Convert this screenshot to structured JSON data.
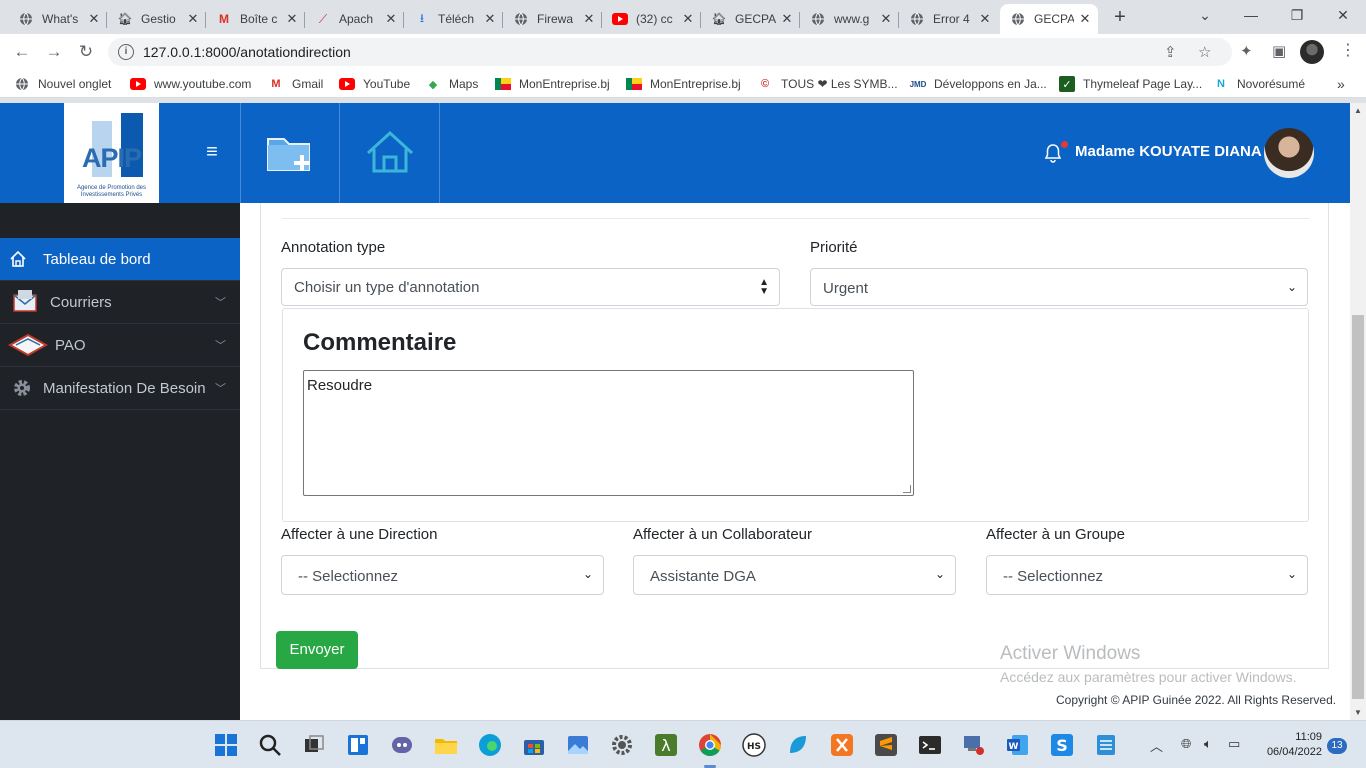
{
  "browser": {
    "tabs": [
      {
        "label": "What's",
        "icon": "globe-icon"
      },
      {
        "label": "Gestio",
        "icon": "house-icon"
      },
      {
        "label": "Boîte c",
        "icon": "gmail-icon"
      },
      {
        "label": "Apach",
        "icon": "apache-icon"
      },
      {
        "label": "Téléch",
        "icon": "download-icon"
      },
      {
        "label": "Firewa",
        "icon": "globe-icon"
      },
      {
        "label": "(32) cc",
        "icon": "youtube-icon"
      },
      {
        "label": "GECPA",
        "icon": "house-icon"
      },
      {
        "label": "www.g",
        "icon": "globe-icon"
      },
      {
        "label": "Error 4",
        "icon": "globe-icon"
      },
      {
        "label": "GECPA",
        "icon": "globe-icon"
      }
    ],
    "url": "127.0.0.1:8000/anotationdirection",
    "bookmarks": [
      "Nouvel onglet",
      "www.youtube.com",
      "Gmail",
      "YouTube",
      "Maps",
      "MonEntreprise.bj",
      "MonEntreprise.bj",
      "TOUS ❤ Les SYMB...",
      "Développons en Ja...",
      "Thymeleaf Page Lay...",
      "Novorésumé"
    ]
  },
  "header": {
    "logo_text": "APIP",
    "logo_subtitle": "Agence de Promotion des Investissements Privés",
    "user_name": "Madame KOUYATE DIANA"
  },
  "sidebar": {
    "items": [
      {
        "label": "Tableau de bord"
      },
      {
        "label": "Courriers"
      },
      {
        "label": "PAO"
      },
      {
        "label": "Manifestation De Besoin"
      }
    ]
  },
  "form": {
    "annotation_label": "Annotation type",
    "annotation_value": "Choisir un type d'annotation",
    "priority_label": "Priorité",
    "priority_value": "Urgent",
    "comment_title": "Commentaire",
    "comment_value": "Resoudre",
    "direction_label": "Affecter à une Direction",
    "direction_value": "-- Selectionnez",
    "collaborator_label": "Affecter à un Collaborateur",
    "collaborator_value": "Assistante DGA",
    "group_label": "Affecter à un Groupe",
    "group_value": "-- Selectionnez",
    "submit_label": "Envoyer"
  },
  "footer": {
    "activation_title": "Activer Windows",
    "activation_text": "Accédez aux paramètres pour activer Windows.",
    "copyright": "Copyright © APIP Guinée 2022. All Rights Reserved."
  },
  "taskbar": {
    "time": "11:09",
    "date": "06/04/2022",
    "notification_count": "13"
  },
  "colors": {
    "primary": "#0b63c6",
    "sidebar_bg": "#1f2327",
    "success": "#28a745"
  }
}
